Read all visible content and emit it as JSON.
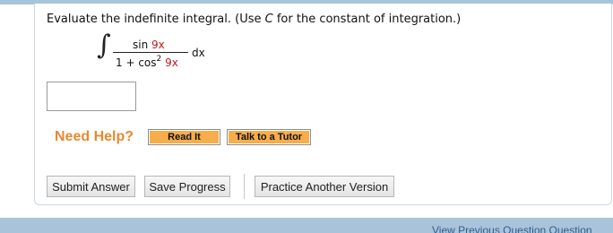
{
  "question": {
    "prompt_before": "Evaluate the indefinite integral. (Use ",
    "prompt_var": "C",
    "prompt_after": " for the constant of integration.)",
    "integral_sign": "∫",
    "numerator_fn": "sin",
    "numerator_arg": "9x",
    "denominator_prefix": "1 + cos",
    "denominator_exp": "2",
    "denominator_arg": "9x",
    "differential": "dx"
  },
  "answer": {
    "value": ""
  },
  "help": {
    "label": "Need Help?",
    "read_it": "Read It",
    "talk_tutor": "Talk to a Tutor"
  },
  "actions": {
    "submit": "Submit Answer",
    "save": "Save Progress",
    "practice": "Practice Another Version"
  },
  "footer": {
    "links_text": "View Previous Question  Question"
  },
  "colors": {
    "accent_red": "#c0191b",
    "help_orange": "#e8892f",
    "help_button": "#f6ad4a",
    "bar_blue": "#a9c3da"
  }
}
